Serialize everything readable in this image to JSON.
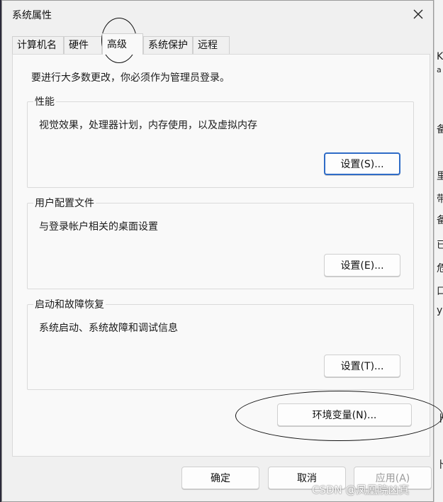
{
  "dialog": {
    "title": "系统属性"
  },
  "tabs": [
    {
      "label": "计算机名",
      "active": false
    },
    {
      "label": "硬件",
      "active": false
    },
    {
      "label": "高级",
      "active": true
    },
    {
      "label": "系统保护",
      "active": false
    },
    {
      "label": "远程",
      "active": false
    }
  ],
  "notice": "要进行大多数更改，你必须作为管理员登录。",
  "groups": {
    "performance": {
      "title": "性能",
      "description": "视觉效果，处理器计划，内存使用，以及虚拟内存",
      "button": "设置(S)..."
    },
    "user_profiles": {
      "title": "用户配置文件",
      "description": "与登录帐户相关的桌面设置",
      "button": "设置(E)..."
    },
    "startup_recovery": {
      "title": "启动和故障恢复",
      "description": "系统启动、系统故障和调试信息",
      "button": "设置(T)..."
    }
  },
  "env_button": "环境变量(N)...",
  "footer": {
    "ok": "确定",
    "cancel": "取消",
    "apply": "应用(A)"
  },
  "background_fragments": [
    "K",
    "a",
    "备",
    "里",
    "带",
    "备",
    "已",
    "危",
    "口",
    "y",
    "卜",
    "卜"
  ],
  "watermark": "CSDN @凤凰院凶真",
  "colors": {
    "dialog_bg": "#f0f0f0",
    "panel_bg": "#f9f9f9",
    "default_button_border": "#2f6cc7",
    "disabled_text": "#9a9a9a"
  }
}
